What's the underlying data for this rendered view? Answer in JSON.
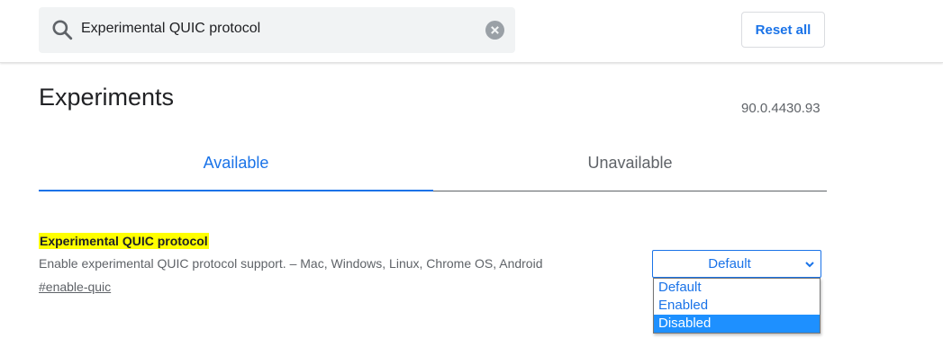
{
  "search": {
    "value": "Experimental QUIC protocol",
    "icon": "search-icon",
    "clear_icon": "clear-icon"
  },
  "header": {
    "reset_label": "Reset all"
  },
  "main": {
    "title": "Experiments",
    "version": "90.0.4430.93",
    "tabs": [
      {
        "label": "Available",
        "active": true
      },
      {
        "label": "Unavailable",
        "active": false
      }
    ]
  },
  "experiment": {
    "name": "Experimental QUIC protocol",
    "description": "Enable experimental QUIC protocol support. – Mac, Windows, Linux, Chrome OS, Android",
    "permalink": "#enable-quic",
    "select": {
      "value": "Default",
      "options": [
        "Default",
        "Enabled",
        "Disabled"
      ],
      "highlighted": "Disabled"
    }
  },
  "colors": {
    "accent": "#1a73e8",
    "highlight": "#ffff00",
    "option_highlight": "#1e90ff",
    "search_bg": "#f1f3f4"
  }
}
